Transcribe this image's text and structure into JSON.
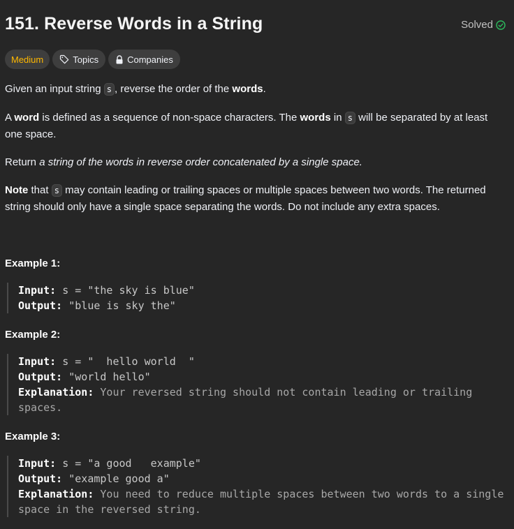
{
  "header": {
    "title": "151. Reverse Words in a String",
    "status": "Solved",
    "status_icon": "check-circle-icon",
    "status_color": "#2cbb5d"
  },
  "tags": {
    "difficulty": "Medium",
    "difficulty_color": "#ffb800",
    "topics": "Topics",
    "topics_icon": "tag-icon",
    "companies": "Companies",
    "companies_icon": "lock-icon"
  },
  "description": {
    "p1_a": "Given an input string ",
    "p1_code": "s",
    "p1_b": ", reverse the order of the ",
    "p1_bold": "words",
    "p1_c": ".",
    "p2_a": "A ",
    "p2_bold1": "word",
    "p2_b": " is defined as a sequence of non-space characters. The ",
    "p2_bold2": "words",
    "p2_c": " in ",
    "p2_code": "s",
    "p2_d": " will be separated by at least one space.",
    "p3_a": "Return ",
    "p3_italic": "a string of the words in reverse order concatenated by a single space.",
    "p4_bold": "Note",
    "p4_a": " that ",
    "p4_code": "s",
    "p4_b": " may contain leading or trailing spaces or multiple spaces between two words. The returned string should only have a single space separating the words. Do not include any extra spaces."
  },
  "examples": [
    {
      "title": "Example 1:",
      "input_label": "Input:",
      "input": " s = \"the sky is blue\"",
      "output_label": "Output:",
      "output": " \"blue is sky the\""
    },
    {
      "title": "Example 2:",
      "input_label": "Input:",
      "input": " s = \"  hello world  \"",
      "output_label": "Output:",
      "output": " \"world hello\"",
      "explanation_label": "Explanation:",
      "explanation": " Your reversed string should not contain leading or trailing spaces."
    },
    {
      "title": "Example 3:",
      "input_label": "Input:",
      "input": " s = \"a good   example\"",
      "output_label": "Output:",
      "output": " \"example good a\"",
      "explanation_label": "Explanation:",
      "explanation": " You need to reduce multiple spaces between two words to a single space in the reversed string."
    }
  ]
}
